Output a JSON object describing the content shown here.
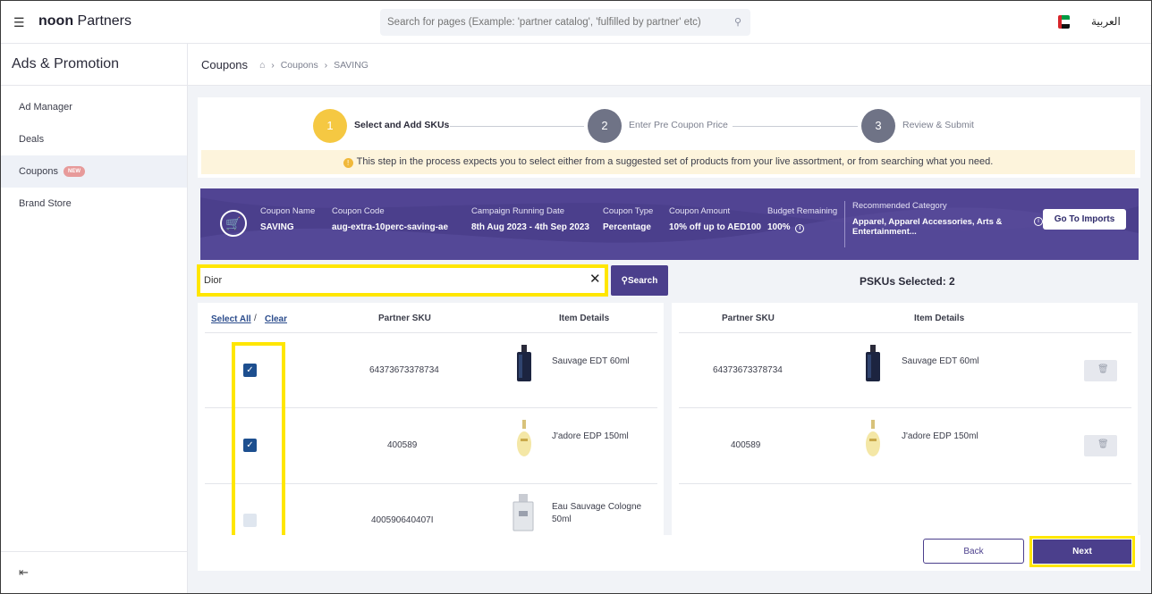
{
  "app": {
    "brand_bold": "noon",
    "brand_rest": " Partners",
    "language_toggle": "العربية"
  },
  "global_search": {
    "placeholder": "Search for pages (Example: 'partner catalog', 'fulfilled by partner' etc)"
  },
  "sidebar": {
    "title": "Ads & Promotion",
    "items": [
      {
        "label": "Ad Manager",
        "active": false
      },
      {
        "label": "Deals",
        "active": false
      },
      {
        "label": "Coupons",
        "active": true,
        "badge": "NEW"
      },
      {
        "label": "Brand Store",
        "active": false
      }
    ]
  },
  "header": {
    "title": "Coupons",
    "breadcrumb": [
      "Coupons",
      "SAVING"
    ]
  },
  "stepper": {
    "steps": [
      {
        "number": "1",
        "label": "Select and Add SKUs",
        "state": "active",
        "color": "#f5c842"
      },
      {
        "number": "2",
        "label": "Enter Pre Coupon Price",
        "state": "pending",
        "color": "#6f7386"
      },
      {
        "number": "3",
        "label": "Review & Submit",
        "state": "pending",
        "color": "#6f7386"
      }
    ],
    "info": "This step in the process expects you to select either from a suggested set of products from your live assortment, or from searching what you need."
  },
  "coupon": {
    "name_label": "Coupon Name",
    "name": "SAVING",
    "code_label": "Coupon Code",
    "code": "aug-extra-10perc-saving-ae",
    "dates_label": "Campaign Running Date",
    "dates": "8th Aug 2023 - 4th Sep 2023",
    "type_label": "Coupon Type",
    "type": "Percentage",
    "amount_label": "Coupon Amount",
    "amount": "10% off up to AED100",
    "budget_label": "Budget Remaining",
    "budget": "100%",
    "category_label": "Recommended Category",
    "category": "Apparel, Apparel Accessories, Arts & Entertainment...",
    "import_button": "Go To Imports"
  },
  "search": {
    "value": "Dior",
    "button": "Search"
  },
  "selected_summary": "PSKUs Selected: 2",
  "results": {
    "select_all": "Select All",
    "separator": "/",
    "clear": "Clear",
    "col_sku": "Partner SKU",
    "col_item": "Item Details",
    "rows": [
      {
        "checked": true,
        "sku": "64373673378734",
        "item": "Sauvage EDT 60ml"
      },
      {
        "checked": true,
        "sku": "400589",
        "item": "J'adore EDP 150ml"
      },
      {
        "checked": false,
        "sku": "400590640407I",
        "item": "Eau Sauvage Cologne 50ml"
      }
    ]
  },
  "selected": {
    "col_sku": "Partner SKU",
    "col_item": "Item Details",
    "rows": [
      {
        "sku": "64373673378734",
        "item": "Sauvage EDT 60ml"
      },
      {
        "sku": "400589",
        "item": "J'adore EDP 150ml"
      }
    ]
  },
  "footer": {
    "back": "Back",
    "next": "Next"
  },
  "colors": {
    "primary": "#4b3f8c",
    "highlight": "#ffe600",
    "step_active": "#f5c842",
    "link": "#2b4c8c"
  }
}
